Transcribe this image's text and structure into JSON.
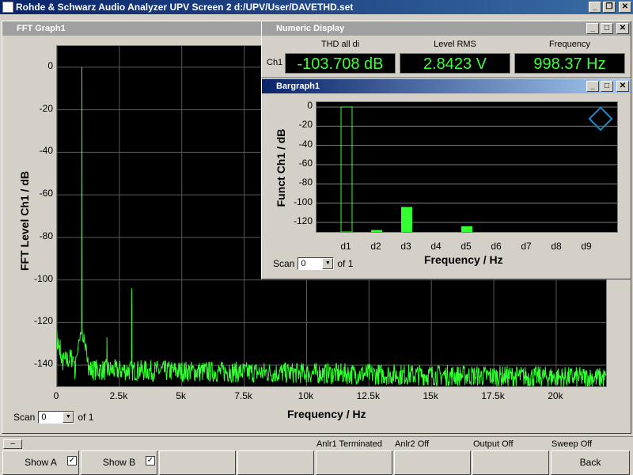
{
  "app": {
    "title": "Rohde & Schwarz Audio Analyzer UPV Screen 2  d:/UPV/User/DAVETHD.set"
  },
  "window_buttons": [
    "_",
    "❐",
    "✕"
  ],
  "fft": {
    "title": "FFT Graph1",
    "ylabel": "FFT Level Ch1 / dB",
    "xlabel": "Frequency / Hz",
    "yticks": [
      "0",
      "-20",
      "-40",
      "-60",
      "-80",
      "-100",
      "-120",
      "-140"
    ],
    "xticks": [
      "0",
      "2.5k",
      "5k",
      "7.5k",
      "10k",
      "12.5k",
      "15k",
      "17.5k",
      "20k"
    ],
    "scan_label": "Scan",
    "scan_value": "0",
    "scan_of": "of 1",
    "trace_color": "#33ff33"
  },
  "numeric": {
    "title": "Numeric Display",
    "channel": "Ch1",
    "columns": [
      {
        "header": "THD all di",
        "value": "-103.708 dB"
      },
      {
        "header": "Level RMS",
        "value": "2.8423 V"
      },
      {
        "header": "Frequency",
        "value": "998.37 Hz"
      }
    ]
  },
  "bargraph": {
    "title": "Bargraph1",
    "ylabel": "Funct Ch1 / dB",
    "xlabel": "Frequency / Hz",
    "yticks": [
      "0",
      "-20",
      "-40",
      "-60",
      "-80",
      "-100",
      "-120"
    ],
    "scan_label": "Scan",
    "scan_value": "0",
    "scan_of": "of 1"
  },
  "chart_data": [
    {
      "type": "line",
      "title": "FFT Graph1",
      "xlabel": "Frequency / Hz",
      "ylabel": "FFT Level Ch1 / dB",
      "xlim": [
        0,
        22000
      ],
      "ylim": [
        -150,
        10
      ],
      "grid": true,
      "x": [
        0,
        1000,
        2000,
        3000,
        5000,
        10000,
        15000,
        20000,
        22000
      ],
      "series": [
        {
          "values": [
            -126,
            0,
            -127,
            -104,
            -141,
            -144,
            -145,
            -146,
            -146
          ]
        }
      ]
    },
    {
      "type": "bar",
      "title": "Bargraph1",
      "xlabel": "Frequency / Hz",
      "ylabel": "Funct Ch1 / dB",
      "ylim": [
        -130,
        5
      ],
      "grid": true,
      "categories": [
        "d1",
        "d2",
        "d3",
        "d4",
        "d5",
        "d6",
        "d7",
        "d8",
        "d9"
      ],
      "values": [
        0,
        -128,
        -104,
        -130,
        -124,
        -130,
        -130,
        -130,
        -130
      ]
    }
  ],
  "bottom": {
    "minus": "–",
    "status": [
      "Anlr1 Terminated",
      "Anlr2 Off",
      "Output Off",
      "Sweep Off"
    ],
    "softkeys": [
      "Show A",
      "Show B",
      "",
      "",
      "",
      "",
      "",
      "Back"
    ],
    "check_mark": "✓"
  }
}
